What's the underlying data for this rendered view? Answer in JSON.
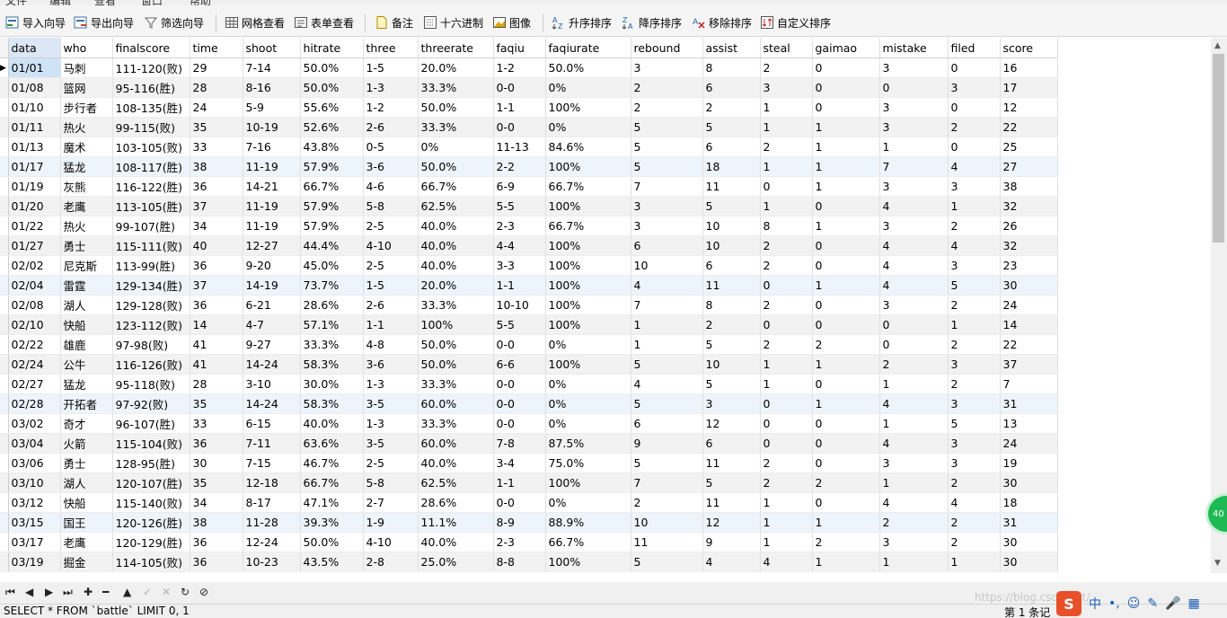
{
  "menu": [
    "文件",
    "编辑",
    "查看",
    "窗口",
    "帮助"
  ],
  "toolbar": {
    "import_wizard": "导入向导",
    "export_wizard": "导出向导",
    "filter_wizard": "筛选向导",
    "grid_view": "网格查看",
    "form_view": "表单查看",
    "memo": "备注",
    "hex": "十六进制",
    "image": "图像",
    "sort_asc": "升序排序",
    "sort_desc": "降序排序",
    "remove_sort": "移除排序",
    "custom_sort": "自定义排序"
  },
  "table": {
    "columns": [
      "data",
      "who",
      "finalscore",
      "time",
      "shoot",
      "hitrate",
      "three",
      "threerate",
      "faqiu",
      "faqiurate",
      "rebound",
      "assist",
      "steal",
      "gaimao",
      "mistake",
      "filed",
      "score"
    ],
    "rows": [
      [
        "01/01",
        "马刺",
        "111-120(败)",
        "29",
        "7-14",
        "50.0%",
        "1-5",
        "20.0%",
        "1-2",
        "50.0%",
        "3",
        "8",
        "2",
        "0",
        "3",
        "0",
        "16"
      ],
      [
        "01/08",
        "篮网",
        "95-116(胜)",
        "28",
        "8-16",
        "50.0%",
        "1-3",
        "33.3%",
        "0-0",
        "0%",
        "2",
        "6",
        "3",
        "0",
        "0",
        "3",
        "17"
      ],
      [
        "01/10",
        "步行者",
        "108-135(胜)",
        "24",
        "5-9",
        "55.6%",
        "1-2",
        "50.0%",
        "1-1",
        "100%",
        "2",
        "2",
        "1",
        "0",
        "3",
        "0",
        "12"
      ],
      [
        "01/11",
        "热火",
        "99-115(败)",
        "35",
        "10-19",
        "52.6%",
        "2-6",
        "33.3%",
        "0-0",
        "0%",
        "5",
        "5",
        "1",
        "1",
        "3",
        "2",
        "22"
      ],
      [
        "01/13",
        "魔术",
        "103-105(败)",
        "33",
        "7-16",
        "43.8%",
        "0-5",
        "0%",
        "11-13",
        "84.6%",
        "5",
        "6",
        "2",
        "1",
        "1",
        "0",
        "25"
      ],
      [
        "01/17",
        "猛龙",
        "108-117(胜)",
        "38",
        "11-19",
        "57.9%",
        "3-6",
        "50.0%",
        "2-2",
        "100%",
        "5",
        "18",
        "1",
        "1",
        "7",
        "4",
        "27"
      ],
      [
        "01/19",
        "灰熊",
        "116-122(胜)",
        "36",
        "14-21",
        "66.7%",
        "4-6",
        "66.7%",
        "6-9",
        "66.7%",
        "7",
        "11",
        "0",
        "1",
        "3",
        "3",
        "38"
      ],
      [
        "01/20",
        "老鹰",
        "113-105(胜)",
        "37",
        "11-19",
        "57.9%",
        "5-8",
        "62.5%",
        "5-5",
        "100%",
        "3",
        "5",
        "1",
        "0",
        "4",
        "1",
        "32"
      ],
      [
        "01/22",
        "热火",
        "99-107(胜)",
        "34",
        "11-19",
        "57.9%",
        "2-5",
        "40.0%",
        "2-3",
        "66.7%",
        "3",
        "10",
        "8",
        "1",
        "3",
        "2",
        "26"
      ],
      [
        "01/27",
        "勇士",
        "115-111(败)",
        "40",
        "12-27",
        "44.4%",
        "4-10",
        "40.0%",
        "4-4",
        "100%",
        "6",
        "10",
        "2",
        "0",
        "4",
        "4",
        "32"
      ],
      [
        "02/02",
        "尼克斯",
        "113-99(胜)",
        "36",
        "9-20",
        "45.0%",
        "2-5",
        "40.0%",
        "3-3",
        "100%",
        "10",
        "6",
        "2",
        "0",
        "4",
        "3",
        "23"
      ],
      [
        "02/04",
        "雷霆",
        "129-134(胜)",
        "37",
        "14-19",
        "73.7%",
        "1-5",
        "20.0%",
        "1-1",
        "100%",
        "4",
        "11",
        "0",
        "1",
        "4",
        "5",
        "30"
      ],
      [
        "02/08",
        "湖人",
        "129-128(败)",
        "36",
        "6-21",
        "28.6%",
        "2-6",
        "33.3%",
        "10-10",
        "100%",
        "7",
        "8",
        "2",
        "0",
        "3",
        "2",
        "24"
      ],
      [
        "02/10",
        "快船",
        "123-112(败)",
        "14",
        "4-7",
        "57.1%",
        "1-1",
        "100%",
        "5-5",
        "100%",
        "1",
        "2",
        "0",
        "0",
        "0",
        "1",
        "14"
      ],
      [
        "02/22",
        "雄鹿",
        "97-98(败)",
        "41",
        "9-27",
        "33.3%",
        "4-8",
        "50.0%",
        "0-0",
        "0%",
        "1",
        "5",
        "2",
        "2",
        "0",
        "2",
        "22"
      ],
      [
        "02/24",
        "公牛",
        "116-126(败)",
        "41",
        "14-24",
        "58.3%",
        "3-6",
        "50.0%",
        "6-6",
        "100%",
        "5",
        "10",
        "1",
        "1",
        "2",
        "3",
        "37"
      ],
      [
        "02/27",
        "猛龙",
        "95-118(败)",
        "28",
        "3-10",
        "30.0%",
        "1-3",
        "33.3%",
        "0-0",
        "0%",
        "4",
        "5",
        "1",
        "0",
        "1",
        "2",
        "7"
      ],
      [
        "02/28",
        "开拓者",
        "97-92(败)",
        "35",
        "14-24",
        "58.3%",
        "3-5",
        "60.0%",
        "0-0",
        "0%",
        "5",
        "3",
        "0",
        "1",
        "4",
        "3",
        "31"
      ],
      [
        "03/02",
        "奇才",
        "96-107(胜)",
        "33",
        "6-15",
        "40.0%",
        "1-3",
        "33.3%",
        "0-0",
        "0%",
        "6",
        "12",
        "0",
        "0",
        "1",
        "5",
        "13"
      ],
      [
        "03/04",
        "火箭",
        "115-104(败)",
        "36",
        "7-11",
        "63.6%",
        "3-5",
        "60.0%",
        "7-8",
        "87.5%",
        "9",
        "6",
        "0",
        "0",
        "4",
        "3",
        "24"
      ],
      [
        "03/06",
        "勇士",
        "128-95(胜)",
        "30",
        "7-15",
        "46.7%",
        "2-5",
        "40.0%",
        "3-4",
        "75.0%",
        "5",
        "11",
        "2",
        "0",
        "3",
        "3",
        "19"
      ],
      [
        "03/10",
        "湖人",
        "120-107(胜)",
        "35",
        "12-18",
        "66.7%",
        "5-8",
        "62.5%",
        "1-1",
        "100%",
        "7",
        "5",
        "2",
        "2",
        "1",
        "2",
        "30"
      ],
      [
        "03/12",
        "快船",
        "115-140(败)",
        "34",
        "8-17",
        "47.1%",
        "2-7",
        "28.6%",
        "0-0",
        "0%",
        "2",
        "11",
        "1",
        "0",
        "4",
        "4",
        "18"
      ],
      [
        "03/15",
        "国王",
        "120-126(胜)",
        "38",
        "11-28",
        "39.3%",
        "1-9",
        "11.1%",
        "8-9",
        "88.9%",
        "10",
        "12",
        "1",
        "1",
        "2",
        "2",
        "31"
      ],
      [
        "03/17",
        "老鹰",
        "120-129(胜)",
        "36",
        "12-24",
        "50.0%",
        "4-10",
        "40.0%",
        "2-3",
        "66.7%",
        "11",
        "9",
        "1",
        "2",
        "3",
        "2",
        "30"
      ],
      [
        "03/19",
        "掘金",
        "114-105(败)",
        "36",
        "10-23",
        "43.5%",
        "2-8",
        "25.0%",
        "8-8",
        "100%",
        "5",
        "4",
        "4",
        "1",
        "1",
        "1",
        "30"
      ]
    ]
  },
  "status": {
    "sql": "SELECT * FROM `battle` LIMIT 0, 1",
    "records": "第 1 条记",
    "watermark": "https://blog.csdn.net/",
    "float_ball": "40"
  },
  "ime": {
    "logo": "S",
    "mode": "中"
  }
}
